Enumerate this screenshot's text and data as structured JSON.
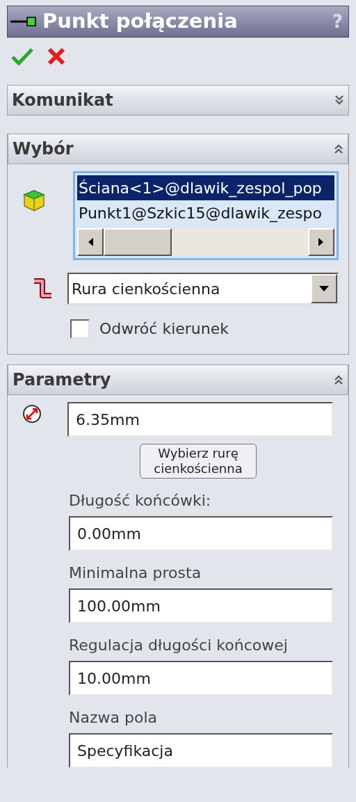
{
  "panel": {
    "title": "Punkt połączenia",
    "help": "?"
  },
  "sections": [
    {
      "kind": "message",
      "title": "Komunikat",
      "expanded": false
    },
    {
      "kind": "selection",
      "title": "Wybór",
      "expanded": true,
      "selections": [
        {
          "text": "Ściana<1>@dlawik_zespol_pop",
          "selected": true
        },
        {
          "text": "Punkt1@Szkic15@dlawik_zespo",
          "selected": false
        }
      ],
      "pipe_type": "Rura cienkościenna",
      "reverse_direction": {
        "label": "Odwróć kierunek",
        "checked": false
      }
    },
    {
      "kind": "parameters",
      "title": "Parametry",
      "expanded": true,
      "diameter": "6.35mm",
      "select_button": "Wybierz rurę cienkościenna",
      "fields": [
        {
          "label": "Długość końcówki:",
          "value": "0.00mm"
        },
        {
          "label": "Minimalna prosta",
          "value": "100.00mm"
        },
        {
          "label": "Regulacja długości końcowej",
          "value": "10.00mm"
        },
        {
          "label": "Nazwa pola",
          "value": "Specyfikacja"
        }
      ]
    }
  ]
}
